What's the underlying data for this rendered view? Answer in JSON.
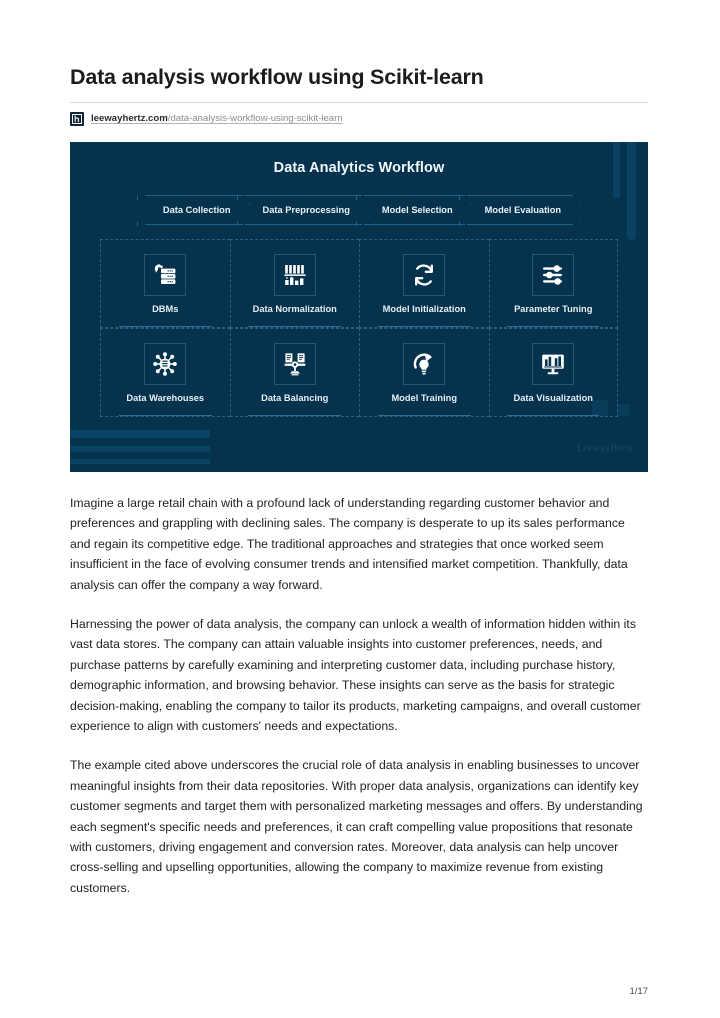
{
  "document": {
    "title": "Data analysis workflow using Scikit-learn",
    "page_number": "1/17"
  },
  "source": {
    "favicon_name": "leewayhertz-favicon",
    "domain": "leewayhertz.com",
    "path": "/data-analysis-workflow-using-scikit-learn"
  },
  "banner": {
    "title": "Data Analytics Workflow",
    "watermark": "LeewayHertz",
    "background_color": "#05334d",
    "accent_color": "#1d6189",
    "steps": [
      {
        "label": "Data Collection"
      },
      {
        "label": "Data Preprocessing"
      },
      {
        "label": "Model Selection"
      },
      {
        "label": "Model Evaluation"
      }
    ],
    "cards": [
      {
        "label": "DBMs",
        "icon": "database-gear-icon"
      },
      {
        "label": "Data Normalization",
        "icon": "normalization-bars-icon"
      },
      {
        "label": "Model Initialization",
        "icon": "refresh-cycle-icon"
      },
      {
        "label": "Parameter Tuning",
        "icon": "sliders-icon"
      },
      {
        "label": "Data Warehouses",
        "icon": "network-hub-icon"
      },
      {
        "label": "Data Balancing",
        "icon": "balance-scale-icon"
      },
      {
        "label": "Model Training",
        "icon": "lightbulb-cycle-icon"
      },
      {
        "label": "Data Visualization",
        "icon": "monitor-chart-icon"
      }
    ]
  },
  "article": {
    "paragraphs": [
      "Imagine a large retail chain with a profound lack of understanding regarding customer behavior and preferences and grappling with declining sales. The company is desperate to up its sales performance and regain its competitive edge. The traditional approaches and strategies that once worked seem insufficient in the face of evolving consumer trends and intensified market competition. Thankfully, data analysis can offer the company a way forward.",
      "Harnessing the power of data analysis, the company can unlock a wealth of information hidden within its vast data stores. The company can attain valuable insights into customer preferences, needs, and purchase patterns by carefully examining and interpreting customer data, including purchase history, demographic information, and browsing behavior. These insights can serve as the basis for strategic decision-making, enabling the company to tailor its products, marketing campaigns, and overall customer experience to align with customers' needs and expectations.",
      "The example cited above underscores the crucial role of data analysis in enabling businesses to uncover meaningful insights from their data repositories. With proper data analysis, organizations can identify key customer segments and target them with personalized marketing messages and offers. By understanding each segment's specific needs and preferences, it can craft compelling value propositions that resonate with customers, driving engagement and conversion rates. Moreover, data analysis can help uncover cross-selling and upselling opportunities, allowing the company to maximize revenue from existing customers."
    ]
  }
}
